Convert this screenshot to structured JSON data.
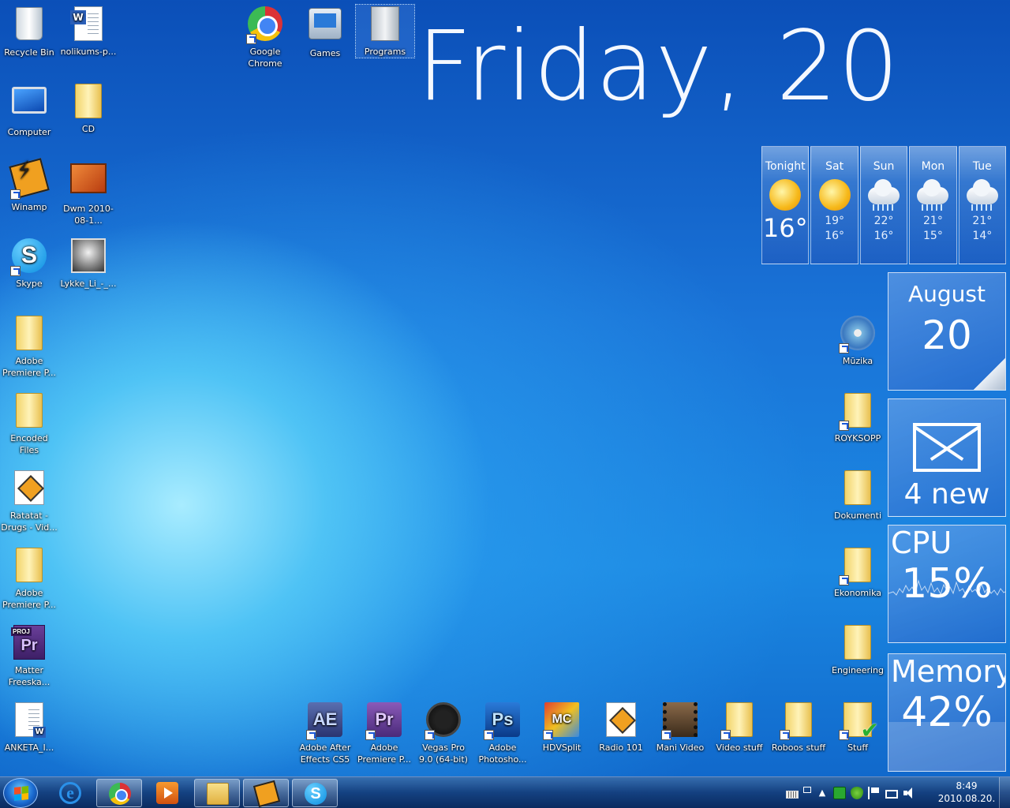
{
  "desktop": {
    "date_banner": "Friday, 20",
    "icons": {
      "recycle_bin": "Recycle Bin",
      "nolikums": "nolikums-p...",
      "google_chrome": "Google Chrome",
      "games": "Games",
      "programs": "Programs",
      "computer": "Computer",
      "cd": "CD",
      "winamp": "Winamp",
      "dwm": "Dwm 2010-08-1...",
      "skype": "Skype",
      "lykke_li": "Lykke_Li_-_...",
      "adobe_premiere_1": "Adobe Premiere P...",
      "encoded_files": "Encoded Files",
      "ratatat": "Ratatat - Drugs - Vid...",
      "adobe_premiere_2": "Adobe Premiere P...",
      "matter_freeska": "Matter Freeska...",
      "anketa": "ANKETA_I...",
      "muzika": "Mūzika",
      "royksopp": "ROYKSOPP",
      "dokumenti": "Dokumenti",
      "ekonomika": "Ekonomika",
      "engineering": "Engineering",
      "after_effects": "Adobe After Effects CS5",
      "premiere_pro": "Adobe Premiere P...",
      "vegas": "Vegas Pro 9.0 (64-bit)",
      "photoshop": "Adobe Photosho...",
      "hdvsplit": "HDVSplit",
      "radio101": "Radio 101",
      "mani_video": "Mani Video",
      "video_stuff": "Video stuff",
      "roboos_stuff": "Roboos stuff",
      "stuff": "Stuff"
    },
    "icon_glyphs": {
      "word_badge": "W",
      "skype_glyph": "S",
      "proj_tag": "PROJ",
      "pr_glyph": "Pr",
      "ae_glyph": "AE",
      "ps_glyph": "Ps",
      "hdv_glyph": "MC"
    }
  },
  "weather": {
    "days": [
      {
        "name": "Tonight",
        "condition": "sunny",
        "temp": "16°"
      },
      {
        "name": "Sat",
        "condition": "sunny",
        "hi": "19°",
        "lo": "16°"
      },
      {
        "name": "Sun",
        "condition": "rain",
        "hi": "22°",
        "lo": "16°"
      },
      {
        "name": "Mon",
        "condition": "rain",
        "hi": "21°",
        "lo": "15°"
      },
      {
        "name": "Tue",
        "condition": "rain",
        "hi": "21°",
        "lo": "14°"
      }
    ]
  },
  "calendar": {
    "month": "August",
    "day": "20"
  },
  "mail": {
    "count_text": "4 new"
  },
  "cpu": {
    "label": "CPU",
    "value_text": "15%",
    "percent": 15
  },
  "memory": {
    "label": "Memory",
    "value_text": "42%",
    "percent": 42
  },
  "taskbar": {
    "pinned": [
      "internet-explorer",
      "google-chrome",
      "windows-media-player",
      "windows-explorer",
      "winamp",
      "skype"
    ],
    "running": [
      "google-chrome",
      "windows-explorer",
      "winamp",
      "skype"
    ],
    "ie_glyph": "e",
    "skype_glyph": "S",
    "tray_arrow": "▲",
    "clock_time": "8:49",
    "clock_date": "2010.08.20."
  },
  "colors": {
    "accent": "#1b88e2",
    "text": "#ffffff"
  }
}
